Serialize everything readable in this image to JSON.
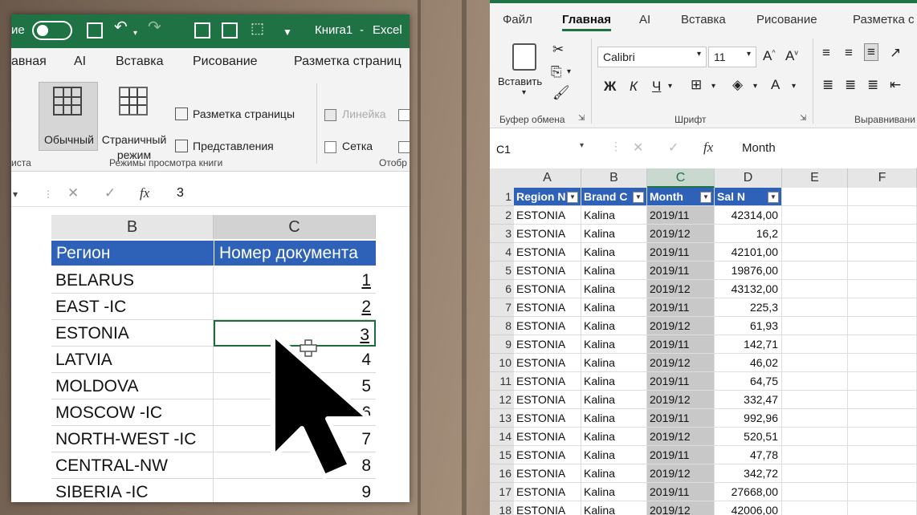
{
  "left": {
    "titlebar": {
      "autosave": "ие",
      "book": "Книга1",
      "sep": "-",
      "app": "Excel"
    },
    "tabs": [
      "авная",
      "AI",
      "Вставка",
      "Рисование",
      "Разметка страниц"
    ],
    "ribbon": {
      "normal": "Обычный",
      "page_layout_line1": "Страничный",
      "page_layout_line2": "режим",
      "page_markup": "Разметка страницы",
      "views": "Представления",
      "ruler": "Линейка",
      "grid": "Сетка",
      "group_views": "Режимы просмотра книги",
      "group_left": "иста",
      "group_right": "Отобр"
    },
    "formula": {
      "fx": "fx",
      "value": "3"
    },
    "columns": [
      "B",
      "C"
    ],
    "header": [
      "Регион",
      "Номер документа"
    ],
    "rows": [
      {
        "region": "BELARUS",
        "num": "1"
      },
      {
        "region": "EAST -IC",
        "num": "2"
      },
      {
        "region": "ESTONIA",
        "num": "3"
      },
      {
        "region": "LATVIA",
        "num": "4"
      },
      {
        "region": "MOLDOVA",
        "num": "5"
      },
      {
        "region": "MOSCOW -IC",
        "num": "6"
      },
      {
        "region": "NORTH-WEST -IC",
        "num": "7"
      },
      {
        "region": "CENTRAL-NW",
        "num": "8"
      },
      {
        "region": "SIBERIA -IC",
        "num": "9"
      }
    ]
  },
  "right": {
    "tabs": [
      "Файл",
      "Главная",
      "AI",
      "Вставка",
      "Рисование",
      "Разметка с"
    ],
    "active_tab": "Главная",
    "ribbon": {
      "paste": "Вставить",
      "font": "Calibri",
      "size": "11",
      "bold": "Ж",
      "italic": "К",
      "underline": "Ч",
      "group_clipboard": "Буфер обмена",
      "group_font": "Шрифт",
      "group_align": "Выравнивани"
    },
    "namebox": "C1",
    "formula": {
      "fx": "fx",
      "value": "Month"
    },
    "columns": [
      "A",
      "B",
      "C",
      "D",
      "E",
      "F"
    ],
    "header": [
      "Region N",
      "Brand C",
      "Month",
      "Sal N"
    ],
    "rows": [
      {
        "n": "1"
      },
      {
        "n": "2",
        "region": "ESTONIA",
        "brand": "Kalina",
        "month": "2019/11",
        "sal": "42314,00"
      },
      {
        "n": "3",
        "region": "ESTONIA",
        "brand": "Kalina",
        "month": "2019/12",
        "sal": "16,2"
      },
      {
        "n": "4",
        "region": "ESTONIA",
        "brand": "Kalina",
        "month": "2019/11",
        "sal": "42101,00"
      },
      {
        "n": "5",
        "region": "ESTONIA",
        "brand": "Kalina",
        "month": "2019/11",
        "sal": "19876,00"
      },
      {
        "n": "6",
        "region": "ESTONIA",
        "brand": "Kalina",
        "month": "2019/12",
        "sal": "43132,00"
      },
      {
        "n": "7",
        "region": "ESTONIA",
        "brand": "Kalina",
        "month": "2019/11",
        "sal": "225,3"
      },
      {
        "n": "8",
        "region": "ESTONIA",
        "brand": "Kalina",
        "month": "2019/12",
        "sal": "61,93"
      },
      {
        "n": "9",
        "region": "ESTONIA",
        "brand": "Kalina",
        "month": "2019/11",
        "sal": "142,71"
      },
      {
        "n": "10",
        "region": "ESTONIA",
        "brand": "Kalina",
        "month": "2019/12",
        "sal": "46,02"
      },
      {
        "n": "11",
        "region": "ESTONIA",
        "brand": "Kalina",
        "month": "2019/11",
        "sal": "64,75"
      },
      {
        "n": "12",
        "region": "ESTONIA",
        "brand": "Kalina",
        "month": "2019/12",
        "sal": "332,47"
      },
      {
        "n": "13",
        "region": "ESTONIA",
        "brand": "Kalina",
        "month": "2019/11",
        "sal": "992,96"
      },
      {
        "n": "14",
        "region": "ESTONIA",
        "brand": "Kalina",
        "month": "2019/12",
        "sal": "520,51"
      },
      {
        "n": "15",
        "region": "ESTONIA",
        "brand": "Kalina",
        "month": "2019/11",
        "sal": "47,78"
      },
      {
        "n": "16",
        "region": "ESTONIA",
        "brand": "Kalina",
        "month": "2019/12",
        "sal": "342,72"
      },
      {
        "n": "17",
        "region": "ESTONIA",
        "brand": "Kalina",
        "month": "2019/11",
        "sal": "27668,00"
      },
      {
        "n": "18",
        "region": "ESTONIA",
        "brand": "Kalina",
        "month": "2019/12",
        "sal": "42006,00"
      }
    ]
  },
  "colors": {
    "excel_green": "#1f7244",
    "header_blue": "#2e62b8",
    "month_col": "#c8c8c8"
  }
}
